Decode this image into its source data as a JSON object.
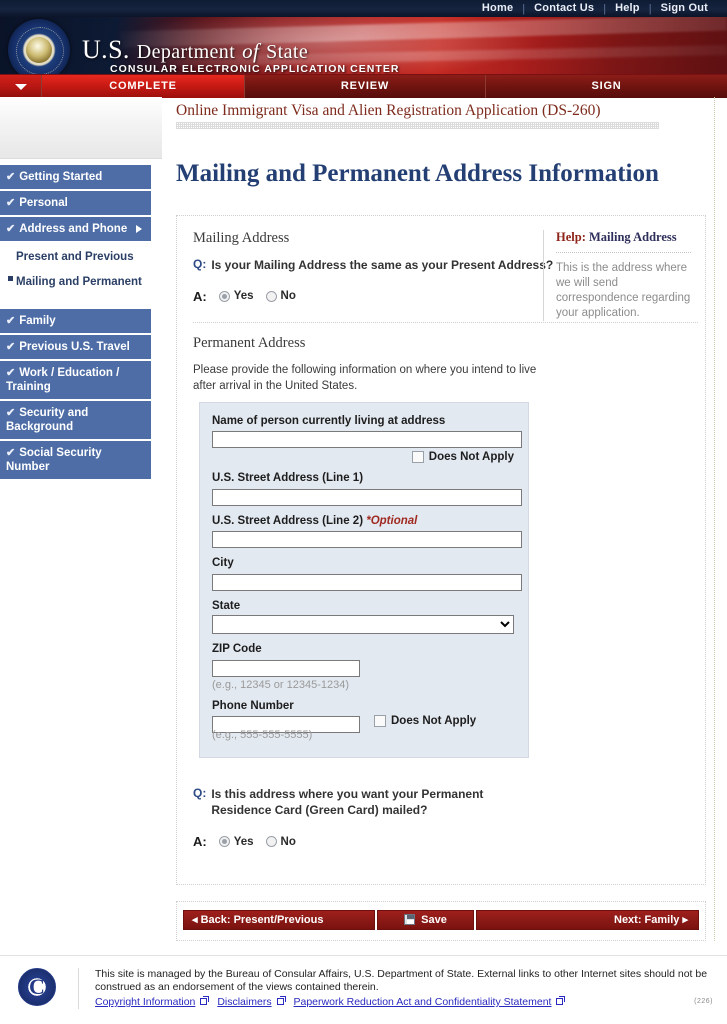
{
  "utility_nav": [
    {
      "label": "Home"
    },
    {
      "label": "Contact Us"
    },
    {
      "label": "Help"
    },
    {
      "label": "Sign Out"
    }
  ],
  "banner": {
    "title_us": "U.S.",
    "title_department": "Department",
    "title_of": "of",
    "title_state": "State",
    "subtitle": "CONSULAR ELECTRONIC APPLICATION CENTER",
    "seal_name": "us-department-of-state-seal"
  },
  "progress_tabs": [
    {
      "label": "COMPLETE",
      "state": "active"
    },
    {
      "label": "REVIEW",
      "state": "inactive"
    },
    {
      "label": "SIGN",
      "state": "inactive"
    }
  ],
  "sidebar": {
    "items": [
      {
        "label": "Getting Started",
        "check": "✔",
        "expandable": false
      },
      {
        "label": "Personal",
        "check": "✔",
        "expandable": false
      },
      {
        "label": "Address and Phone",
        "check": "✔",
        "expandable": true
      }
    ],
    "subitems": [
      {
        "label": "Present and Previous",
        "active": false
      },
      {
        "label": "Mailing and Permanent",
        "active": true
      }
    ],
    "items_after": [
      {
        "label": "Family",
        "check": "✔"
      },
      {
        "label": "Previous U.S. Travel",
        "check": "✔"
      },
      {
        "label": "Work / Education / Training",
        "check": "✔"
      },
      {
        "label": "Security and Background",
        "check": "✔"
      },
      {
        "label": "Social Security Number",
        "check": "✔"
      }
    ]
  },
  "main": {
    "app_name": "Online Immigrant Visa and Alien Registration Application (DS-260)",
    "page_title": "Mailing and Permanent Address Information",
    "mailing": {
      "section_heading": "Mailing Address",
      "q_marker": "Q:",
      "question": "Is your Mailing Address the same as your Present Address?",
      "a_marker": "A:",
      "options": [
        {
          "label": "Yes",
          "selected": true
        },
        {
          "label": "No",
          "selected": false
        }
      ]
    },
    "help": {
      "title_prefix": "Help:",
      "title_subject": "Mailing Address",
      "body": "This is the address where we will send correspondence regarding your application."
    },
    "permanent": {
      "section_heading": "Permanent Address",
      "intro": "Please provide the following information on where you intend to live after arrival in the United States.",
      "fields": [
        {
          "label": "Name of person currently living at address",
          "value": "",
          "type": "text",
          "does_not_apply": "Does Not Apply",
          "hint": ""
        },
        {
          "label": "U.S. Street Address (Line 1)",
          "value": "",
          "type": "text",
          "hint": ""
        },
        {
          "label": "U.S. Street Address (Line 2)",
          "optional": "*Optional",
          "value": "",
          "type": "text",
          "hint": ""
        },
        {
          "label": "City",
          "value": "",
          "type": "text",
          "hint": ""
        },
        {
          "label": "State",
          "value": "",
          "type": "select",
          "hint": ""
        },
        {
          "label": "ZIP Code",
          "value": "",
          "type": "text-short",
          "hint": "(e.g., 12345 or 12345-1234)"
        },
        {
          "label": "Phone Number",
          "value": "",
          "type": "text-short",
          "hint": "(e.g., 555-555-5555)",
          "does_not_apply": "Does Not Apply"
        }
      ]
    },
    "green_card": {
      "q_marker": "Q:",
      "question": "Is this address where you want your Permanent Residence Card (Green Card) mailed?",
      "a_marker": "A:",
      "options": [
        {
          "label": "Yes",
          "selected": true
        },
        {
          "label": "No",
          "selected": false
        }
      ]
    },
    "buttons": {
      "back": "◂ Back: Present/Previous",
      "save": "Save",
      "next": "Next: Family ▸"
    }
  },
  "footer": {
    "text": "This site is managed by the Bureau of Consular Affairs, U.S. Department of State. External links to other Internet sites should not be construed as an endorsement of the views contained therein.",
    "links": [
      {
        "label": "Copyright Information"
      },
      {
        "label": "Disclaimers"
      },
      {
        "label": "Paperwork Reduction Act and Confidentiality Statement"
      }
    ],
    "code": "(226)",
    "seal_name": "consular-affairs-seal"
  },
  "colors": {
    "banner_red": "#b3221f",
    "nav_blue": "#4e6da6",
    "title_blue": "#243f73",
    "app_title_red": "#7e2b1d",
    "button_red": "#8d1a17",
    "form_bg": "#e3e9f1",
    "link_blue": "#2a2ac0"
  }
}
